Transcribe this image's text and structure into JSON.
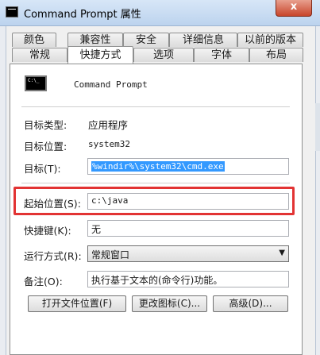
{
  "window": {
    "title": "Command Prompt 属性",
    "close_label": "x"
  },
  "tabs": {
    "row1": [
      "颜色",
      "兼容性",
      "安全",
      "详细信息",
      "以前的版本"
    ],
    "row2": [
      "常规",
      "快捷方式",
      "选项",
      "字体",
      "布局"
    ],
    "active": "快捷方式"
  },
  "shortcut": {
    "app_name": "Command Prompt",
    "target_type_label": "目标类型:",
    "target_type_value": "应用程序",
    "target_location_label": "目标位置:",
    "target_location_value": "system32",
    "target_label": "目标(T):",
    "target_value": "%windir%\\system32\\cmd.exe",
    "start_in_label": "起始位置(S):",
    "start_in_value": "c:\\java",
    "shortcut_key_label": "快捷键(K):",
    "shortcut_key_value": "无",
    "run_label": "运行方式(R):",
    "run_value": "常规窗口",
    "comment_label": "备注(O):",
    "comment_value": "执行基于文本的(命令行)功能。"
  },
  "buttons": {
    "open_location": "打开文件位置(F)",
    "change_icon": "更改图标(C)...",
    "advanced": "高级(D)..."
  },
  "colors": {
    "highlight_border": "#e23333",
    "selection": "#3399ff"
  }
}
